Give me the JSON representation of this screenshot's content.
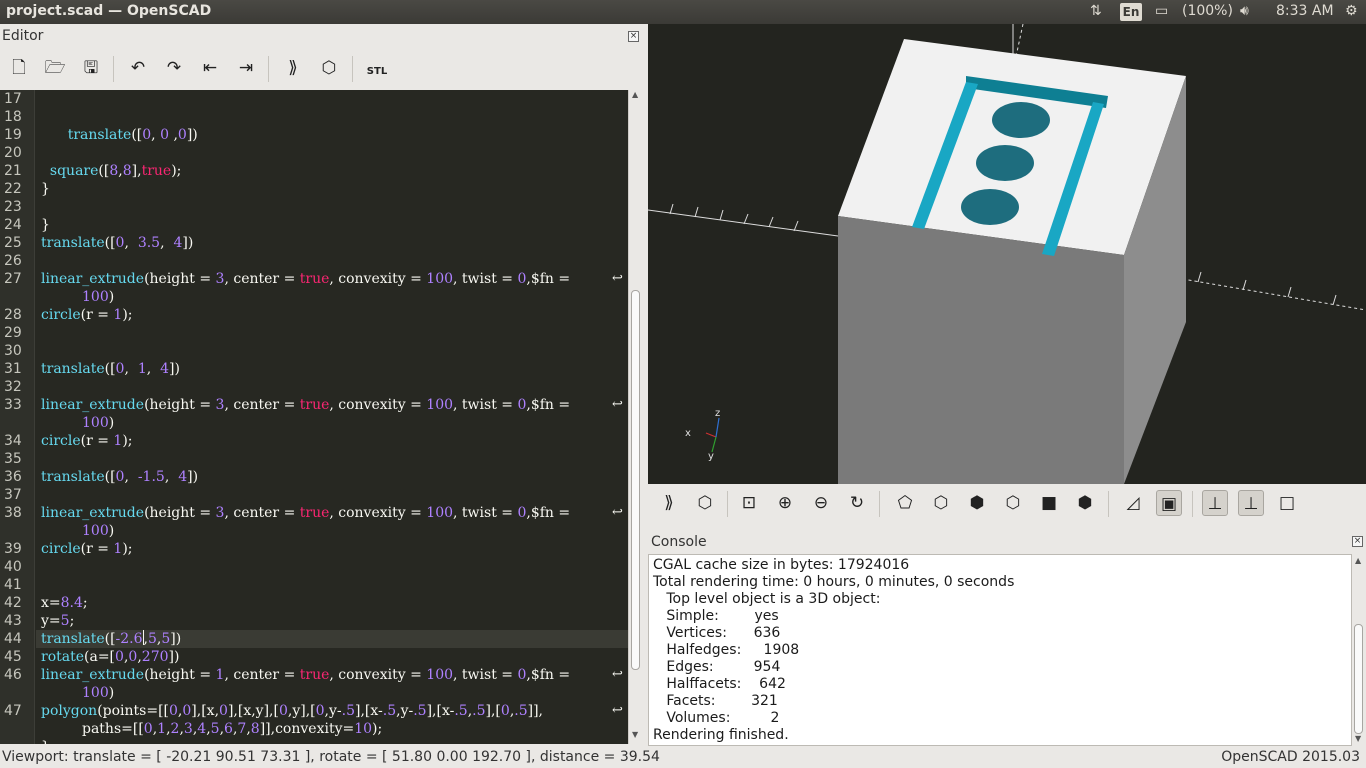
{
  "window": {
    "title": "project.scad — OpenSCAD"
  },
  "topbar": {
    "lang": "En",
    "battery": "(100%)",
    "time": "8:33 AM"
  },
  "editor": {
    "title": "Editor",
    "lines": [
      {
        "n": "17",
        "tokens": []
      },
      {
        "n": "18",
        "tokens": []
      },
      {
        "n": "19",
        "tokens": [
          {
            "t": "      "
          },
          {
            "t": "translate",
            "c": "k"
          },
          {
            "t": "(["
          },
          {
            "t": "0",
            "c": "n"
          },
          {
            "t": ", "
          },
          {
            "t": "0",
            "c": "n"
          },
          {
            "t": " ,"
          },
          {
            "t": "0",
            "c": "n"
          },
          {
            "t": "])"
          }
        ]
      },
      {
        "n": "20",
        "tokens": []
      },
      {
        "n": "21",
        "tokens": [
          {
            "t": "  "
          },
          {
            "t": "square",
            "c": "k"
          },
          {
            "t": "(["
          },
          {
            "t": "8",
            "c": "n"
          },
          {
            "t": ","
          },
          {
            "t": "8",
            "c": "n"
          },
          {
            "t": "],"
          },
          {
            "t": "true",
            "c": "t"
          },
          {
            "t": ");"
          }
        ]
      },
      {
        "n": "22",
        "tokens": [
          {
            "t": "}"
          }
        ]
      },
      {
        "n": "23",
        "tokens": []
      },
      {
        "n": "24",
        "tokens": [
          {
            "t": "}"
          }
        ]
      },
      {
        "n": "25",
        "tokens": [
          {
            "t": "translate",
            "c": "k"
          },
          {
            "t": "(["
          },
          {
            "t": "0",
            "c": "n"
          },
          {
            "t": ",  "
          },
          {
            "t": "3.5",
            "c": "n"
          },
          {
            "t": ",  "
          },
          {
            "t": "4",
            "c": "n"
          },
          {
            "t": "])"
          }
        ]
      },
      {
        "n": "26",
        "tokens": []
      },
      {
        "n": "27",
        "wrap": true,
        "tokens": [
          {
            "t": "linear_extrude",
            "c": "k"
          },
          {
            "t": "(height = "
          },
          {
            "t": "3",
            "c": "n"
          },
          {
            "t": ", center = "
          },
          {
            "t": "true",
            "c": "t"
          },
          {
            "t": ", convexity = "
          },
          {
            "t": "100",
            "c": "n"
          },
          {
            "t": ", twist = "
          },
          {
            "t": "0",
            "c": "n"
          },
          {
            "t": ",$fn = "
          }
        ],
        "cont": [
          {
            "t": "100",
            "c": "n"
          },
          {
            "t": ")"
          }
        ]
      },
      {
        "n": "28",
        "tokens": [
          {
            "t": "circle",
            "c": "k"
          },
          {
            "t": "(r = "
          },
          {
            "t": "1",
            "c": "n"
          },
          {
            "t": ");"
          }
        ]
      },
      {
        "n": "29",
        "tokens": []
      },
      {
        "n": "30",
        "tokens": []
      },
      {
        "n": "31",
        "tokens": [
          {
            "t": "translate",
            "c": "k"
          },
          {
            "t": "(["
          },
          {
            "t": "0",
            "c": "n"
          },
          {
            "t": ",  "
          },
          {
            "t": "1",
            "c": "n"
          },
          {
            "t": ",  "
          },
          {
            "t": "4",
            "c": "n"
          },
          {
            "t": "])"
          }
        ]
      },
      {
        "n": "32",
        "tokens": []
      },
      {
        "n": "33",
        "wrap": true,
        "tokens": [
          {
            "t": "linear_extrude",
            "c": "k"
          },
          {
            "t": "(height = "
          },
          {
            "t": "3",
            "c": "n"
          },
          {
            "t": ", center = "
          },
          {
            "t": "true",
            "c": "t"
          },
          {
            "t": ", convexity = "
          },
          {
            "t": "100",
            "c": "n"
          },
          {
            "t": ", twist = "
          },
          {
            "t": "0",
            "c": "n"
          },
          {
            "t": ",$fn = "
          }
        ],
        "cont": [
          {
            "t": "100",
            "c": "n"
          },
          {
            "t": ")"
          }
        ]
      },
      {
        "n": "34",
        "tokens": [
          {
            "t": "circle",
            "c": "k"
          },
          {
            "t": "(r = "
          },
          {
            "t": "1",
            "c": "n"
          },
          {
            "t": ");"
          }
        ]
      },
      {
        "n": "35",
        "tokens": []
      },
      {
        "n": "36",
        "tokens": [
          {
            "t": "translate",
            "c": "k"
          },
          {
            "t": "(["
          },
          {
            "t": "0",
            "c": "n"
          },
          {
            "t": ",  "
          },
          {
            "t": "-1.5",
            "c": "n"
          },
          {
            "t": ",  "
          },
          {
            "t": "4",
            "c": "n"
          },
          {
            "t": "])"
          }
        ]
      },
      {
        "n": "37",
        "tokens": []
      },
      {
        "n": "38",
        "wrap": true,
        "tokens": [
          {
            "t": "linear_extrude",
            "c": "k"
          },
          {
            "t": "(height = "
          },
          {
            "t": "3",
            "c": "n"
          },
          {
            "t": ", center = "
          },
          {
            "t": "true",
            "c": "t"
          },
          {
            "t": ", convexity = "
          },
          {
            "t": "100",
            "c": "n"
          },
          {
            "t": ", twist = "
          },
          {
            "t": "0",
            "c": "n"
          },
          {
            "t": ",$fn = "
          }
        ],
        "cont": [
          {
            "t": "100",
            "c": "n"
          },
          {
            "t": ")"
          }
        ]
      },
      {
        "n": "39",
        "tokens": [
          {
            "t": "circle",
            "c": "k"
          },
          {
            "t": "(r = "
          },
          {
            "t": "1",
            "c": "n"
          },
          {
            "t": ");"
          }
        ]
      },
      {
        "n": "40",
        "tokens": []
      },
      {
        "n": "41",
        "tokens": []
      },
      {
        "n": "42",
        "tokens": [
          {
            "t": "x="
          },
          {
            "t": "8.4",
            "c": "n"
          },
          {
            "t": ";"
          }
        ]
      },
      {
        "n": "43",
        "tokens": [
          {
            "t": "y="
          },
          {
            "t": "5",
            "c": "n"
          },
          {
            "t": ";"
          }
        ]
      },
      {
        "n": "44",
        "current": true,
        "tokens": [
          {
            "t": "translate",
            "c": "k"
          },
          {
            "t": "(["
          },
          {
            "t": "-2.6",
            "c": "n"
          },
          {
            "cursor": true
          },
          {
            "t": ","
          },
          {
            "t": "5",
            "c": "n"
          },
          {
            "t": ","
          },
          {
            "t": "5",
            "c": "n"
          },
          {
            "t": "])"
          }
        ]
      },
      {
        "n": "45",
        "tokens": [
          {
            "t": "rotate",
            "c": "k"
          },
          {
            "t": "(a=["
          },
          {
            "t": "0",
            "c": "n"
          },
          {
            "t": ","
          },
          {
            "t": "0",
            "c": "n"
          },
          {
            "t": ","
          },
          {
            "t": "270",
            "c": "n"
          },
          {
            "t": "])"
          }
        ]
      },
      {
        "n": "46",
        "wrap": true,
        "tokens": [
          {
            "t": "linear_extrude",
            "c": "k"
          },
          {
            "t": "(height = "
          },
          {
            "t": "1",
            "c": "n"
          },
          {
            "t": ", center = "
          },
          {
            "t": "true",
            "c": "t"
          },
          {
            "t": ", convexity = "
          },
          {
            "t": "100",
            "c": "n"
          },
          {
            "t": ", twist = "
          },
          {
            "t": "0",
            "c": "n"
          },
          {
            "t": ",$fn = "
          }
        ],
        "cont": [
          {
            "t": "100",
            "c": "n"
          },
          {
            "t": ")"
          }
        ]
      },
      {
        "n": "47",
        "wrap": true,
        "tokens": [
          {
            "t": "polygon",
            "c": "k"
          },
          {
            "t": "(points=[["
          },
          {
            "t": "0",
            "c": "n"
          },
          {
            "t": ","
          },
          {
            "t": "0",
            "c": "n"
          },
          {
            "t": "],[x,"
          },
          {
            "t": "0",
            "c": "n"
          },
          {
            "t": "],[x,y],["
          },
          {
            "t": "0",
            "c": "n"
          },
          {
            "t": ",y],["
          },
          {
            "t": "0",
            "c": "n"
          },
          {
            "t": ",y-"
          },
          {
            "t": ".5",
            "c": "n"
          },
          {
            "t": "],[x-"
          },
          {
            "t": ".5",
            "c": "n"
          },
          {
            "t": ",y-"
          },
          {
            "t": ".5",
            "c": "n"
          },
          {
            "t": "],[x-"
          },
          {
            "t": ".5",
            "c": "n"
          },
          {
            "t": ","
          },
          {
            "t": ".5",
            "c": "n"
          },
          {
            "t": "],["
          },
          {
            "t": "0",
            "c": "n"
          },
          {
            "t": ","
          },
          {
            "t": ".5",
            "c": "n"
          },
          {
            "t": "]],"
          }
        ],
        "cont": [
          {
            "t": "paths=[["
          },
          {
            "t": "0",
            "c": "n"
          },
          {
            "t": ","
          },
          {
            "t": "1",
            "c": "n"
          },
          {
            "t": ","
          },
          {
            "t": "2",
            "c": "n"
          },
          {
            "t": ","
          },
          {
            "t": "3",
            "c": "n"
          },
          {
            "t": ","
          },
          {
            "t": "4",
            "c": "n"
          },
          {
            "t": ","
          },
          {
            "t": "5",
            "c": "n"
          },
          {
            "t": ","
          },
          {
            "t": "6",
            "c": "n"
          },
          {
            "t": ","
          },
          {
            "t": "7",
            "c": "n"
          },
          {
            "t": ","
          },
          {
            "t": "8",
            "c": "n"
          },
          {
            "t": "]],convexity="
          },
          {
            "t": "10",
            "c": "n"
          },
          {
            "t": ");"
          }
        ]
      }
    ]
  },
  "toolbar": {
    "editor_icons": [
      "new-file-icon",
      "open-file-icon",
      "save-icon",
      "undo-icon",
      "redo-icon",
      "unindent-icon",
      "indent-icon",
      "preview-icon",
      "render-icon",
      "export-stl-icon"
    ],
    "stl_label": "STL",
    "view_icons": [
      "preview-icon",
      "render-icon",
      "view-all-icon",
      "zoom-in-icon",
      "zoom-out-icon",
      "reset-view-icon",
      "view-top-icon",
      "view-bottom-icon",
      "view-left-icon",
      "view-right-icon",
      "view-front-icon",
      "view-back-icon",
      "perspective-icon",
      "orthogonal-icon",
      "show-axes-icon",
      "show-scale-icon",
      "show-edges-icon"
    ]
  },
  "console": {
    "title": "Console",
    "lines": [
      "CGAL cache size in bytes: 17924016",
      "Total rendering time: 0 hours, 0 minutes, 0 seconds",
      "   Top level object is a 3D object:",
      "   Simple:        yes",
      "   Vertices:      636",
      "   Halfedges:     1908",
      "   Edges:         954",
      "   Halffacets:    642",
      "   Facets:        321",
      "   Volumes:         2",
      "Rendering finished."
    ]
  },
  "status": {
    "viewport": "Viewport: translate = [ -20.21 90.51 73.31 ], rotate = [ 51.80 0.00 192.70 ], distance = 39.54",
    "version": "OpenSCAD 2015.03"
  },
  "axes": {
    "x": "x",
    "y": "y",
    "z": "z"
  },
  "colors": {
    "editor_bg": "#272822",
    "keyword": "#66d9ef",
    "number": "#ae81ff",
    "bool": "#f92672",
    "model_top": "#f1f1f1",
    "model_side": "#7a7a7a",
    "model_accent": "#19a7c4"
  }
}
